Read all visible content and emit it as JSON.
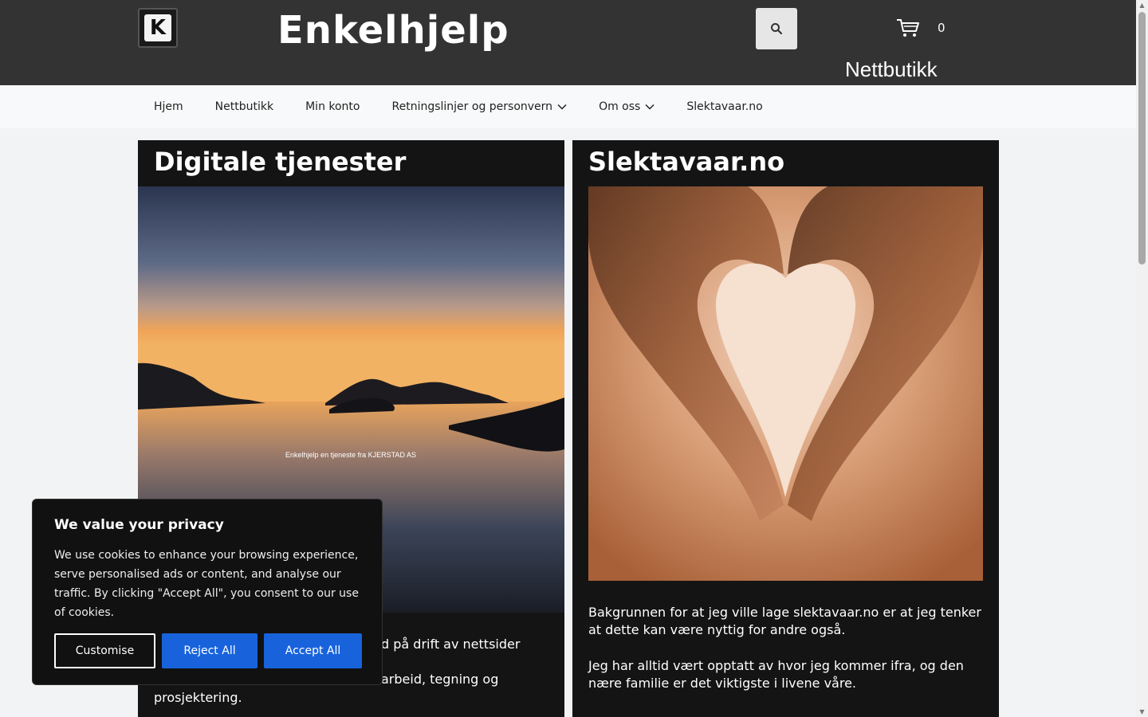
{
  "header": {
    "logo_letter": "K",
    "site_title": "Enkelhjelp",
    "cart_count": "0",
    "shop_label": "Nettbutikk"
  },
  "nav": {
    "items": [
      {
        "label": "Hjem"
      },
      {
        "label": "Nettbutikk"
      },
      {
        "label": "Min konto"
      },
      {
        "label": "Retningslinjer og personvern"
      },
      {
        "label": "Om oss"
      },
      {
        "label": "Slektavaar.no"
      }
    ]
  },
  "cards": {
    "left": {
      "title": "Digitale tjenester",
      "image_caption": "Enkelhjelp en tjeneste fra KJERSTAD AS",
      "text1": "d på drift av nettsider",
      "text2": "arbeid, tegning og",
      "text3": "prosjektering."
    },
    "right": {
      "title": "Slektavaar.no",
      "p1": "Bakgrunnen for at jeg ville lage slektavaar.no er at jeg tenker at dette kan være nyttig for andre også.",
      "p2": "Jeg har alltid vært opptatt av hvor jeg kommer ifra, og den nære familie er det viktigste i livene våre."
    }
  },
  "cookie": {
    "title": "We value your privacy",
    "body": "We use cookies to enhance your browsing experience, serve personalised ads or content, and analyse our traffic. By clicking \"Accept All\", you consent to our use of cookies.",
    "customise": "Customise",
    "reject": "Reject All",
    "accept": "Accept All"
  },
  "icons": {
    "search": "search-icon",
    "cart": "cart-icon",
    "chevron": "chevron-down-icon"
  }
}
